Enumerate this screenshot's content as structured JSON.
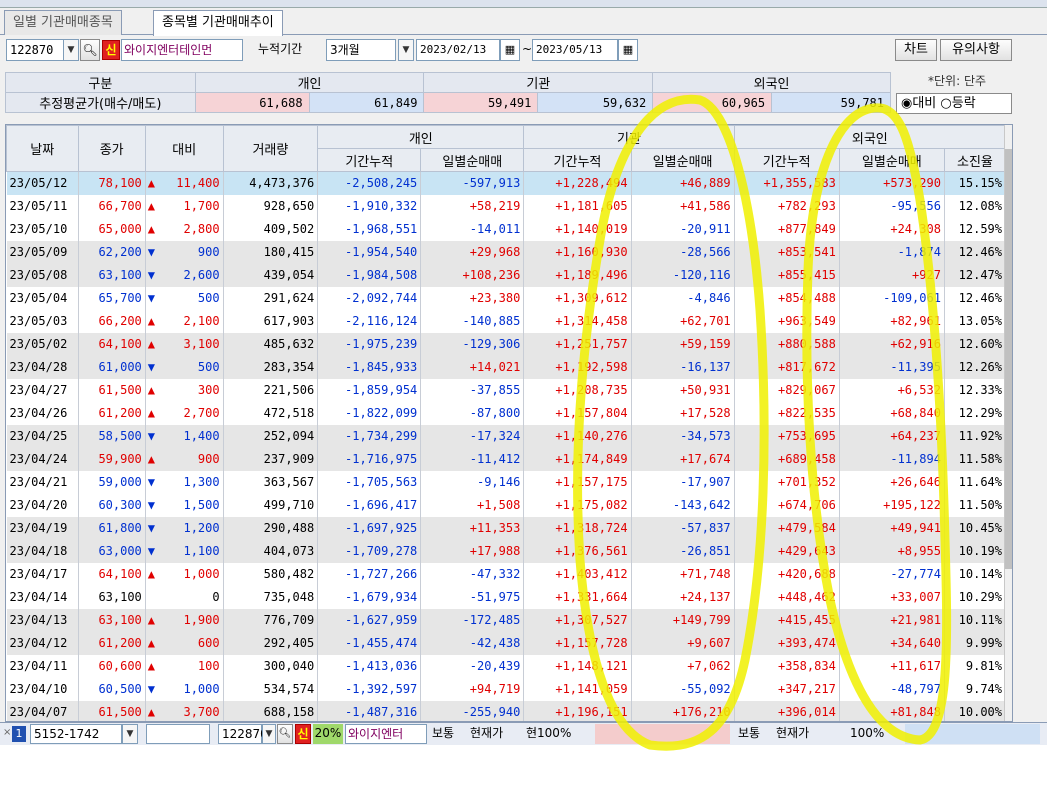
{
  "tabs": [
    "일별 기관매매종목",
    "종목별 기관매매추이"
  ],
  "controls": {
    "code": "122870",
    "sin_label": "신",
    "stock_name": "와이지엔터테인먼",
    "period_label": "누적기간",
    "period_value": "3개월",
    "date_from": "2023/02/13",
    "tilde": "~",
    "date_to": "2023/05/13",
    "chart_button": "차트",
    "caution_button": "유의사항"
  },
  "summary": {
    "col_category": "구분",
    "col_individual": "개인",
    "col_institution": "기관",
    "col_foreign": "외국인",
    "row_label": "추정평균가(매수/매도)",
    "individual_buy": "61,688",
    "individual_sell": "61,849",
    "institution_buy": "59,491",
    "institution_sell": "59,632",
    "foreign_buy": "60,965",
    "foreign_sell": "59,781",
    "unit": "*단위: 단주",
    "radio_daebi": "대비",
    "radio_deungrak": "등락"
  },
  "grid": {
    "headers": {
      "date": "날짜",
      "close": "종가",
      "change": "대비",
      "volume": "거래량",
      "individual": "개인",
      "institution": "기관",
      "foreign": "외국인",
      "cumulative": "기간누적",
      "daily_net": "일별순매매",
      "exhaustion": "소진율"
    },
    "rows": [
      {
        "date": "23/05/12",
        "close": "78,100",
        "dir": "up",
        "chg": "11,400",
        "vol": "4,473,376",
        "i_cum": "-2,508,245",
        "i_day": "-597,913",
        "n_cum": "+1,228,494",
        "n_day": "+46,889",
        "f_cum": "+1,355,583",
        "f_day": "+573,290",
        "rate": "15.15%"
      },
      {
        "date": "23/05/11",
        "close": "66,700",
        "dir": "up",
        "chg": "1,700",
        "vol": "928,650",
        "i_cum": "-1,910,332",
        "i_day": "+58,219",
        "n_cum": "+1,181,605",
        "n_day": "+41,586",
        "f_cum": "+782,293",
        "f_day": "-95,556",
        "rate": "12.08%"
      },
      {
        "date": "23/05/10",
        "close": "65,000",
        "dir": "up",
        "chg": "2,800",
        "vol": "409,502",
        "i_cum": "-1,968,551",
        "i_day": "-14,011",
        "n_cum": "+1,140,019",
        "n_day": "-20,911",
        "f_cum": "+877,849",
        "f_day": "+24,308",
        "rate": "12.59%"
      },
      {
        "date": "23/05/09",
        "close": "62,200",
        "dir": "dn",
        "chg": "900",
        "vol": "180,415",
        "i_cum": "-1,954,540",
        "i_day": "+29,968",
        "n_cum": "+1,160,930",
        "n_day": "-28,566",
        "f_cum": "+853,541",
        "f_day": "-1,874",
        "rate": "12.46%"
      },
      {
        "date": "23/05/08",
        "close": "63,100",
        "dir": "dn",
        "chg": "2,600",
        "vol": "439,054",
        "i_cum": "-1,984,508",
        "i_day": "+108,236",
        "n_cum": "+1,189,496",
        "n_day": "-120,116",
        "f_cum": "+855,415",
        "f_day": "+927",
        "rate": "12.47%"
      },
      {
        "date": "23/05/04",
        "close": "65,700",
        "dir": "dn",
        "chg": "500",
        "vol": "291,624",
        "i_cum": "-2,092,744",
        "i_day": "+23,380",
        "n_cum": "+1,309,612",
        "n_day": "-4,846",
        "f_cum": "+854,488",
        "f_day": "-109,061",
        "rate": "12.46%"
      },
      {
        "date": "23/05/03",
        "close": "66,200",
        "dir": "up",
        "chg": "2,100",
        "vol": "617,903",
        "i_cum": "-2,116,124",
        "i_day": "-140,885",
        "n_cum": "+1,314,458",
        "n_day": "+62,701",
        "f_cum": "+963,549",
        "f_day": "+82,961",
        "rate": "13.05%"
      },
      {
        "date": "23/05/02",
        "close": "64,100",
        "dir": "up",
        "chg": "3,100",
        "vol": "485,632",
        "i_cum": "-1,975,239",
        "i_day": "-129,306",
        "n_cum": "+1,251,757",
        "n_day": "+59,159",
        "f_cum": "+880,588",
        "f_day": "+62,916",
        "rate": "12.60%"
      },
      {
        "date": "23/04/28",
        "close": "61,000",
        "dir": "dn",
        "chg": "500",
        "vol": "283,354",
        "i_cum": "-1,845,933",
        "i_day": "+14,021",
        "n_cum": "+1,192,598",
        "n_day": "-16,137",
        "f_cum": "+817,672",
        "f_day": "-11,395",
        "rate": "12.26%"
      },
      {
        "date": "23/04/27",
        "close": "61,500",
        "dir": "up",
        "chg": "300",
        "vol": "221,506",
        "i_cum": "-1,859,954",
        "i_day": "-37,855",
        "n_cum": "+1,208,735",
        "n_day": "+50,931",
        "f_cum": "+829,067",
        "f_day": "+6,532",
        "rate": "12.33%"
      },
      {
        "date": "23/04/26",
        "close": "61,200",
        "dir": "up",
        "chg": "2,700",
        "vol": "472,518",
        "i_cum": "-1,822,099",
        "i_day": "-87,800",
        "n_cum": "+1,157,804",
        "n_day": "+17,528",
        "f_cum": "+822,535",
        "f_day": "+68,840",
        "rate": "12.29%"
      },
      {
        "date": "23/04/25",
        "close": "58,500",
        "dir": "dn",
        "chg": "1,400",
        "vol": "252,094",
        "i_cum": "-1,734,299",
        "i_day": "-17,324",
        "n_cum": "+1,140,276",
        "n_day": "-34,573",
        "f_cum": "+753,695",
        "f_day": "+64,237",
        "rate": "11.92%"
      },
      {
        "date": "23/04/24",
        "close": "59,900",
        "dir": "up",
        "chg": "900",
        "vol": "237,909",
        "i_cum": "-1,716,975",
        "i_day": "-11,412",
        "n_cum": "+1,174,849",
        "n_day": "+17,674",
        "f_cum": "+689,458",
        "f_day": "-11,894",
        "rate": "11.58%"
      },
      {
        "date": "23/04/21",
        "close": "59,000",
        "dir": "dn",
        "chg": "1,300",
        "vol": "363,567",
        "i_cum": "-1,705,563",
        "i_day": "-9,146",
        "n_cum": "+1,157,175",
        "n_day": "-17,907",
        "f_cum": "+701,352",
        "f_day": "+26,646",
        "rate": "11.64%"
      },
      {
        "date": "23/04/20",
        "close": "60,300",
        "dir": "dn",
        "chg": "1,500",
        "vol": "499,710",
        "i_cum": "-1,696,417",
        "i_day": "+1,508",
        "n_cum": "+1,175,082",
        "n_day": "-143,642",
        "f_cum": "+674,706",
        "f_day": "+195,122",
        "rate": "11.50%"
      },
      {
        "date": "23/04/19",
        "close": "61,800",
        "dir": "dn",
        "chg": "1,200",
        "vol": "290,488",
        "i_cum": "-1,697,925",
        "i_day": "+11,353",
        "n_cum": "+1,318,724",
        "n_day": "-57,837",
        "f_cum": "+479,584",
        "f_day": "+49,941",
        "rate": "10.45%"
      },
      {
        "date": "23/04/18",
        "close": "63,000",
        "dir": "dn",
        "chg": "1,100",
        "vol": "404,073",
        "i_cum": "-1,709,278",
        "i_day": "+17,988",
        "n_cum": "+1,376,561",
        "n_day": "-26,851",
        "f_cum": "+429,643",
        "f_day": "+8,955",
        "rate": "10.19%"
      },
      {
        "date": "23/04/17",
        "close": "64,100",
        "dir": "up",
        "chg": "1,000",
        "vol": "580,482",
        "i_cum": "-1,727,266",
        "i_day": "-47,332",
        "n_cum": "+1,403,412",
        "n_day": "+71,748",
        "f_cum": "+420,688",
        "f_day": "-27,774",
        "rate": "10.14%"
      },
      {
        "date": "23/04/14",
        "close": "63,100",
        "dir": "none",
        "chg": "0",
        "vol": "735,048",
        "i_cum": "-1,679,934",
        "i_day": "-51,975",
        "n_cum": "+1,331,664",
        "n_day": "+24,137",
        "f_cum": "+448,462",
        "f_day": "+33,007",
        "rate": "10.29%"
      },
      {
        "date": "23/04/13",
        "close": "63,100",
        "dir": "up",
        "chg": "1,900",
        "vol": "776,709",
        "i_cum": "-1,627,959",
        "i_day": "-172,485",
        "n_cum": "+1,307,527",
        "n_day": "+149,799",
        "f_cum": "+415,455",
        "f_day": "+21,981",
        "rate": "10.11%"
      },
      {
        "date": "23/04/12",
        "close": "61,200",
        "dir": "up",
        "chg": "600",
        "vol": "292,405",
        "i_cum": "-1,455,474",
        "i_day": "-42,438",
        "n_cum": "+1,157,728",
        "n_day": "+9,607",
        "f_cum": "+393,474",
        "f_day": "+34,640",
        "rate": "9.99%"
      },
      {
        "date": "23/04/11",
        "close": "60,600",
        "dir": "up",
        "chg": "100",
        "vol": "300,040",
        "i_cum": "-1,413,036",
        "i_day": "-20,439",
        "n_cum": "+1,148,121",
        "n_day": "+7,062",
        "f_cum": "+358,834",
        "f_day": "+11,617",
        "rate": "9.81%"
      },
      {
        "date": "23/04/10",
        "close": "60,500",
        "dir": "dn",
        "chg": "1,000",
        "vol": "534,574",
        "i_cum": "-1,392,597",
        "i_day": "+94,719",
        "n_cum": "+1,141,059",
        "n_day": "-55,092",
        "f_cum": "+347,217",
        "f_day": "-48,797",
        "rate": "9.74%"
      },
      {
        "date": "23/04/07",
        "close": "61,500",
        "dir": "up",
        "chg": "3,700",
        "vol": "688,158",
        "i_cum": "-1,487,316",
        "i_day": "-255,940",
        "n_cum": "+1,196,151",
        "n_day": "+176,210",
        "f_cum": "+396,014",
        "f_day": "+81,848",
        "rate": "10.00%"
      }
    ]
  },
  "bottom": {
    "num": "1",
    "acct": "5152-1742",
    "code": "122870",
    "sin": "신",
    "pct": "20%",
    "name": "와이지엔터",
    "t1": "보통",
    "t2": "현재가",
    "t3": "현100%",
    "t4": "보통",
    "t5": "현재가",
    "t6": "100%"
  }
}
